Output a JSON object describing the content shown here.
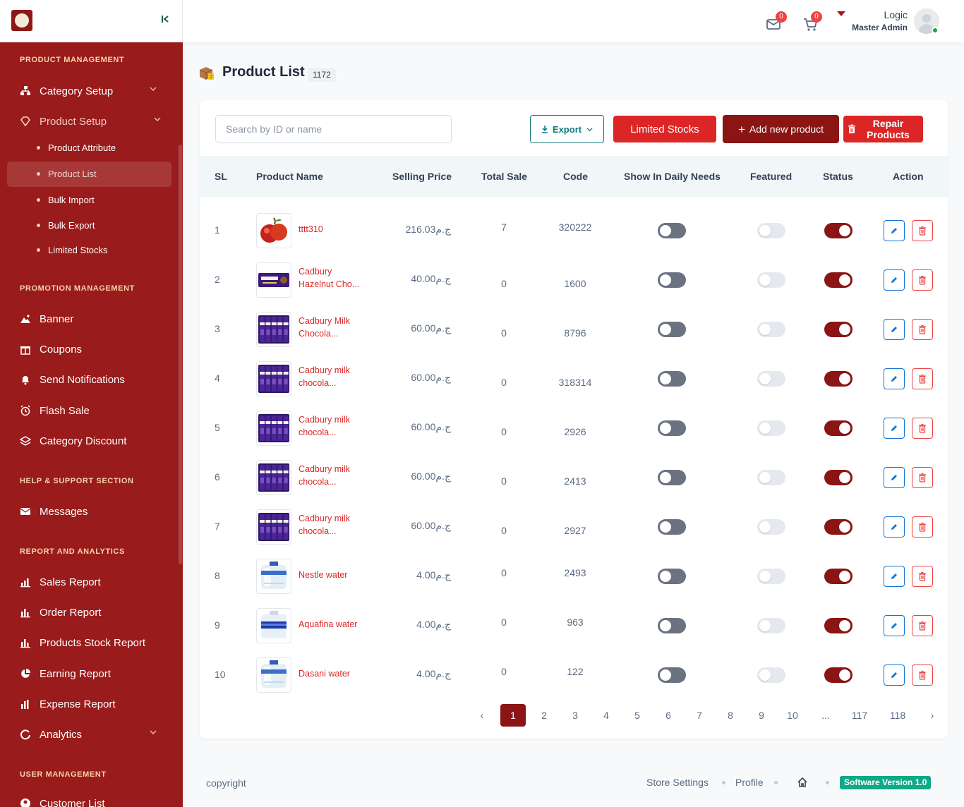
{
  "sidebar": {
    "sections": {
      "product": "PRODUCT MANAGEMENT",
      "promotion": "PROMOTION MANAGEMENT",
      "help": "HELP & SUPPORT SECTION",
      "report": "REPORT AND ANALYTICS",
      "user": "USER MANAGEMENT"
    },
    "items": {
      "category_setup": "Category Setup",
      "product_setup": "Product Setup",
      "product_attribute": "Product Attribute",
      "product_list": "Product List",
      "bulk_import": "Bulk Import",
      "bulk_export": "Bulk Export",
      "limited_stocks": "Limited Stocks",
      "banner": "Banner",
      "coupons": "Coupons",
      "send_notifications": "Send Notifications",
      "flash_sale": "Flash Sale",
      "category_discount": "Category Discount",
      "messages": "Messages",
      "sales_report": "Sales Report",
      "order_report": "Order Report",
      "products_stock_report": "Products Stock Report",
      "earning_report": "Earning Report",
      "expense_report": "Expense Report",
      "analytics": "Analytics",
      "customer_list": "Customer List"
    }
  },
  "header": {
    "messages_count": "0",
    "cart_count": "0",
    "user_name": "Logic",
    "user_role": "Master Admin"
  },
  "page": {
    "title": "Product List",
    "count": "1172"
  },
  "toolbar": {
    "search_placeholder": "Search by ID or name",
    "export": "Export",
    "limited_stocks": "Limited Stocks",
    "add_new": "Add new product",
    "repair_line1": "Repair",
    "repair_line2": "Products"
  },
  "table": {
    "headers": {
      "sl": "SL",
      "name": "Product Name",
      "price": "Selling Price",
      "sale": "Total Sale",
      "code": "Code",
      "daily": "Show In Daily Needs",
      "featured": "Featured",
      "status": "Status",
      "action": "Action"
    },
    "rows": [
      {
        "sl": "1",
        "name1": "tttt310",
        "name2": "",
        "price": "216.03ج.م",
        "sale": "7",
        "code": "320222",
        "thumb": "apple"
      },
      {
        "sl": "2",
        "name1": "Cadbury",
        "name2": "Hazelnut Cho...",
        "price": "40.00ج.م",
        "sale": "0",
        "code": "1600",
        "thumb": "chocolate-bar"
      },
      {
        "sl": "3",
        "name1": "Cadbury Milk",
        "name2": "Chocola...",
        "price": "60.00ج.م",
        "sale": "0",
        "code": "8796",
        "thumb": "chocolate-box"
      },
      {
        "sl": "4",
        "name1": "Cadbury milk",
        "name2": "chocola...",
        "price": "60.00ج.م",
        "sale": "0",
        "code": "318314",
        "thumb": "chocolate-box"
      },
      {
        "sl": "5",
        "name1": "Cadbury milk",
        "name2": "chocola...",
        "price": "60.00ج.م",
        "sale": "0",
        "code": "2926",
        "thumb": "chocolate-box"
      },
      {
        "sl": "6",
        "name1": "Cadbury milk",
        "name2": "chocola...",
        "price": "60.00ج.م",
        "sale": "0",
        "code": "2413",
        "thumb": "chocolate-box"
      },
      {
        "sl": "7",
        "name1": "Cadbury milk",
        "name2": "chocola...",
        "price": "60.00ج.م",
        "sale": "0",
        "code": "2927",
        "thumb": "chocolate-box"
      },
      {
        "sl": "8",
        "name1": "Nestle water",
        "name2": "",
        "price": "4.00ج.م",
        "sale": "0",
        "code": "2493",
        "thumb": "water-bottle"
      },
      {
        "sl": "9",
        "name1": "Aquafina water",
        "name2": "",
        "price": "4.00ج.م",
        "sale": "0",
        "code": "963",
        "thumb": "water-bottle-blue"
      },
      {
        "sl": "10",
        "name1": "Dasani water",
        "name2": "",
        "price": "4.00ج.م",
        "sale": "0",
        "code": "122",
        "thumb": "water-bottle"
      }
    ]
  },
  "pagination": {
    "prev": "‹",
    "next": "›",
    "pages": [
      "1",
      "2",
      "3",
      "4",
      "5",
      "6",
      "7",
      "8",
      "9",
      "10",
      "...",
      "117",
      "118"
    ],
    "active": "1"
  },
  "footer": {
    "copyright": "copyright",
    "store_settings": "Store Settings",
    "profile": "Profile",
    "version": "Software Version 1.0"
  },
  "colors": {
    "brand": "#991b1b",
    "accent_dark": "#8b1414",
    "danger": "#dc2626",
    "teal": "#107980",
    "version_green": "#0fa987"
  }
}
